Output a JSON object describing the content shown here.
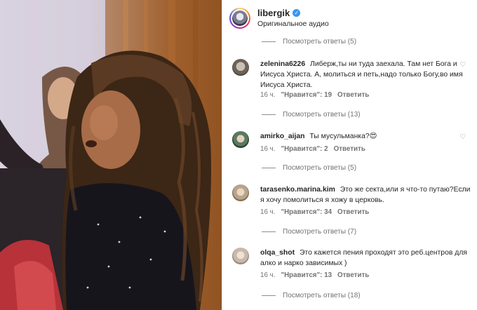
{
  "header": {
    "username": "libergik",
    "subtitle": "Оригинальное аудио"
  },
  "view_replies": [
    "Посмотреть ответы (5)",
    "Посмотреть ответы (13)",
    "Посмотреть ответы (5)",
    "Посмотреть ответы (7)",
    "Посмотреть ответы (18)"
  ],
  "comments": [
    {
      "user": "zelenina6226",
      "text": "Либерж,ты ни туда заехала. Там нет Бога и Иисуса Христа. А, молиться и петь,надо только Богу,во имя Иисуса Христа.",
      "time": "16 ч.",
      "likes": "\"Нравится\": 19",
      "reply": "Ответить"
    },
    {
      "user": "amirko_aijan",
      "text": "Ты мусульманка?😍",
      "time": "16 ч.",
      "likes": "\"Нравится\": 2",
      "reply": "Ответить"
    },
    {
      "user": "tarasenko.marina.kim",
      "text": "Это же секта,или я что-то путаю?Если я хочу помолиться я хожу в церковь.",
      "time": "16 ч.",
      "likes": "\"Нравится\": 34",
      "reply": "Ответить"
    },
    {
      "user": "olqa_shot",
      "text": "Это кажется пения проходят это реб.центров для алко и нарко зависимых )",
      "time": "16 ч.",
      "likes": "\"Нравится\": 13",
      "reply": "Ответить"
    }
  ],
  "icons": {
    "verified": "verified-badge-icon",
    "like": "heart-outline-icon"
  },
  "colors": {
    "verified": "#3897f0",
    "meta": "#737373",
    "text": "#262626"
  }
}
